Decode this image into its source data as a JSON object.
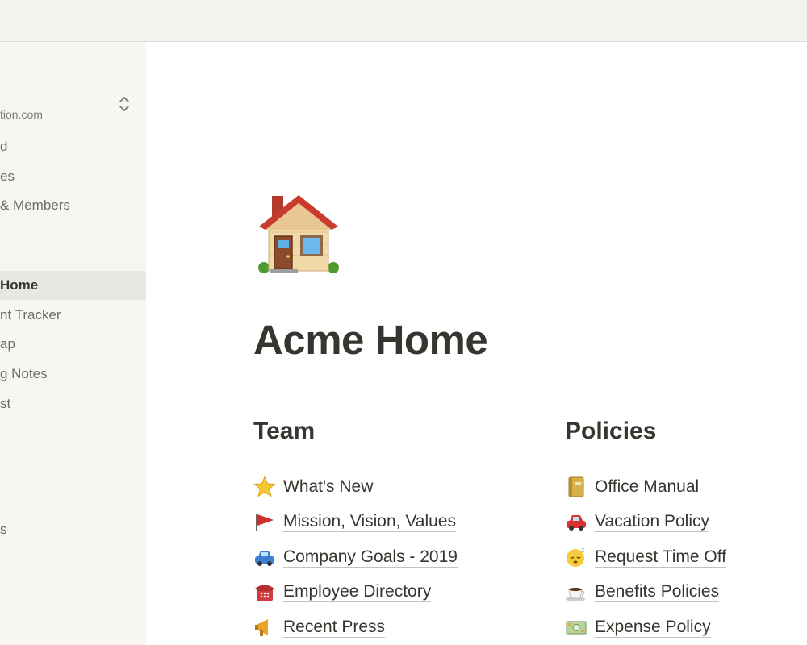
{
  "sidebar": {
    "workspace_email": "tion.com",
    "items_top": [
      {
        "label": "d"
      },
      {
        "label": "es"
      },
      {
        "label": "& Members"
      }
    ],
    "items_pages": [
      {
        "label": "Home",
        "active": true
      },
      {
        "label": "nt Tracker"
      },
      {
        "label": "ap"
      },
      {
        "label": "g Notes"
      },
      {
        "label": "st"
      }
    ],
    "items_bottom": [
      {
        "label": "s"
      }
    ]
  },
  "page": {
    "icon": "house-icon",
    "title": "Acme Home"
  },
  "columns": [
    {
      "heading": "Team",
      "links": [
        {
          "icon": "star-icon",
          "label": "What's New"
        },
        {
          "icon": "red-flag-icon",
          "label": "Mission, Vision, Values"
        },
        {
          "icon": "car-icon",
          "label": "Company Goals - 2019"
        },
        {
          "icon": "telephone-icon",
          "label": "Employee Directory"
        },
        {
          "icon": "megaphone-icon",
          "label": "Recent Press"
        }
      ]
    },
    {
      "heading": "Policies",
      "links": [
        {
          "icon": "notebook-icon",
          "label": "Office Manual"
        },
        {
          "icon": "red-car-icon",
          "label": "Vacation Policy"
        },
        {
          "icon": "sleeping-face-icon",
          "label": "Request Time Off"
        },
        {
          "icon": "coffee-icon",
          "label": "Benefits Policies"
        },
        {
          "icon": "money-icon",
          "label": "Expense Policy"
        }
      ]
    }
  ]
}
